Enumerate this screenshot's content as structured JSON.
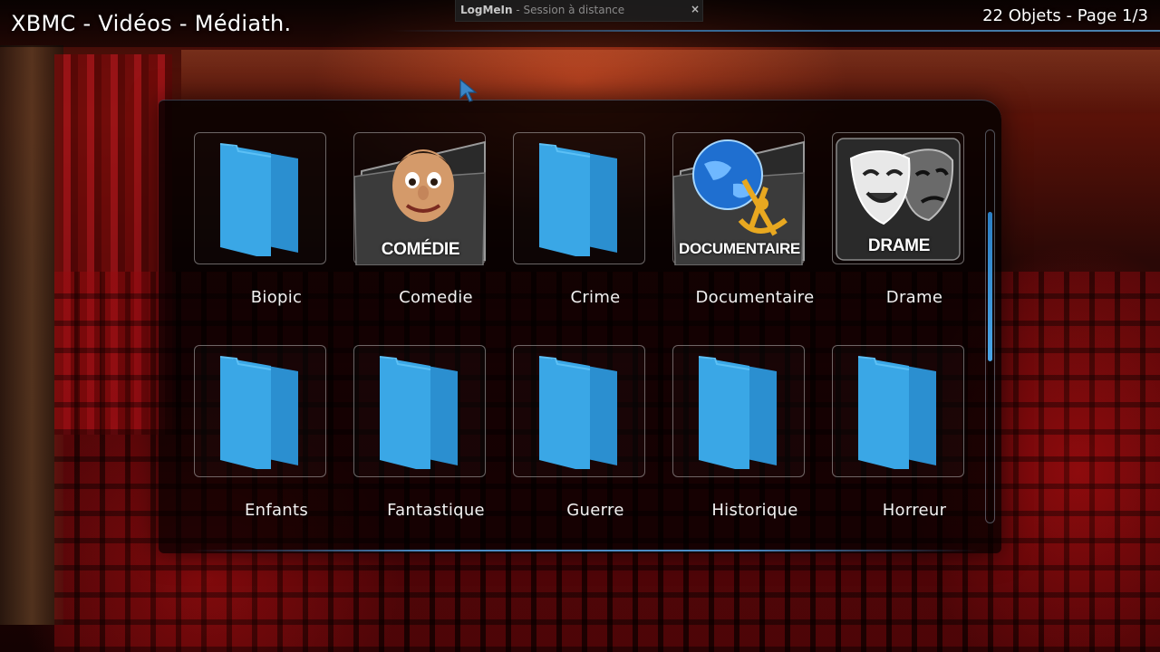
{
  "header": {
    "title": "XBMC - Vidéos - Médiath.",
    "page_info": "22 Objets - Page 1/3"
  },
  "remote_tab": {
    "brand": "LogMeIn",
    "subtitle": " - Session à distance",
    "close": "×"
  },
  "grid": {
    "items": [
      {
        "label": "Biopic",
        "icon": "folder-icon"
      },
      {
        "label": "Comedie",
        "icon": "comedy-thumbnail",
        "caption": "COMÉDIE"
      },
      {
        "label": "Crime",
        "icon": "folder-icon"
      },
      {
        "label": "Documentaire",
        "icon": "documentary-thumbnail",
        "caption": "DOCUMENTAIRE"
      },
      {
        "label": "Drame",
        "icon": "drama-masks-thumbnail",
        "caption": "DRAME"
      },
      {
        "label": "Enfants",
        "icon": "folder-icon"
      },
      {
        "label": "Fantastique",
        "icon": "folder-icon"
      },
      {
        "label": "Guerre",
        "icon": "folder-icon"
      },
      {
        "label": "Historique",
        "icon": "folder-icon"
      },
      {
        "label": "Horreur",
        "icon": "folder-icon"
      }
    ]
  },
  "scroll": {
    "page": 1,
    "total_pages": 3,
    "fraction_visible": 0.38
  },
  "colors": {
    "accent": "#3da0e6",
    "folder": "#3aa3e0",
    "panel": "#000000"
  }
}
